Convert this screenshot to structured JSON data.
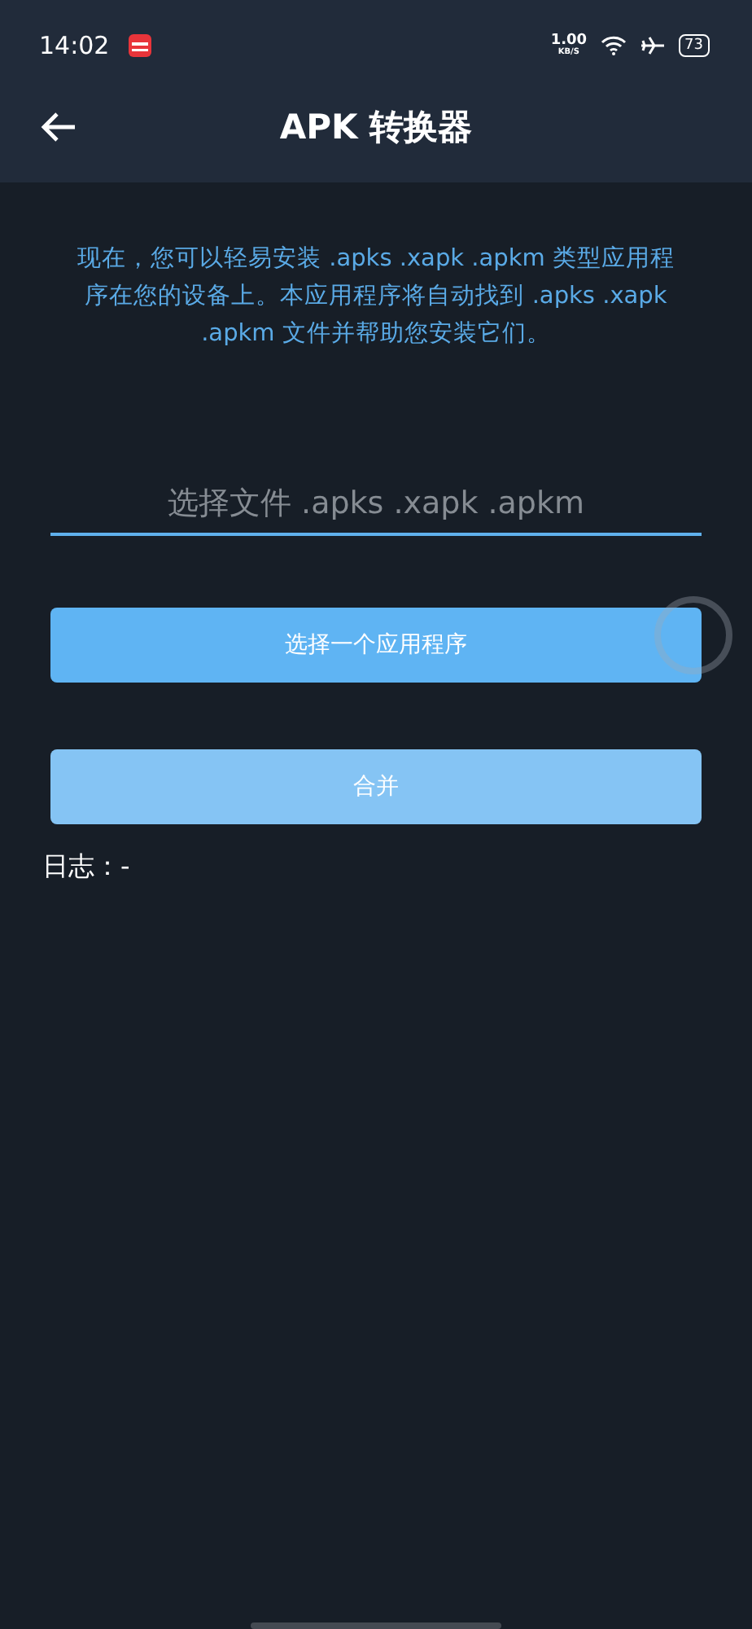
{
  "status_bar": {
    "time": "14:02",
    "net_speed": "1.00",
    "net_unit": "KB/S",
    "battery": "73"
  },
  "app_bar": {
    "title": "APK 转换器"
  },
  "description": "现在，您可以轻易安装 .apks .xapk .apkm 类型应用程序在您的设备上。本应用程序将自动找到 .apks .xapk .apkm 文件并帮助您安装它们。",
  "file_field": {
    "placeholder": "选择文件 .apks .xapk .apkm"
  },
  "buttons": [
    {
      "label": "选择一个应用程序",
      "disabled": false
    },
    {
      "label": "合并",
      "disabled": true
    }
  ],
  "log": "日志：-"
}
